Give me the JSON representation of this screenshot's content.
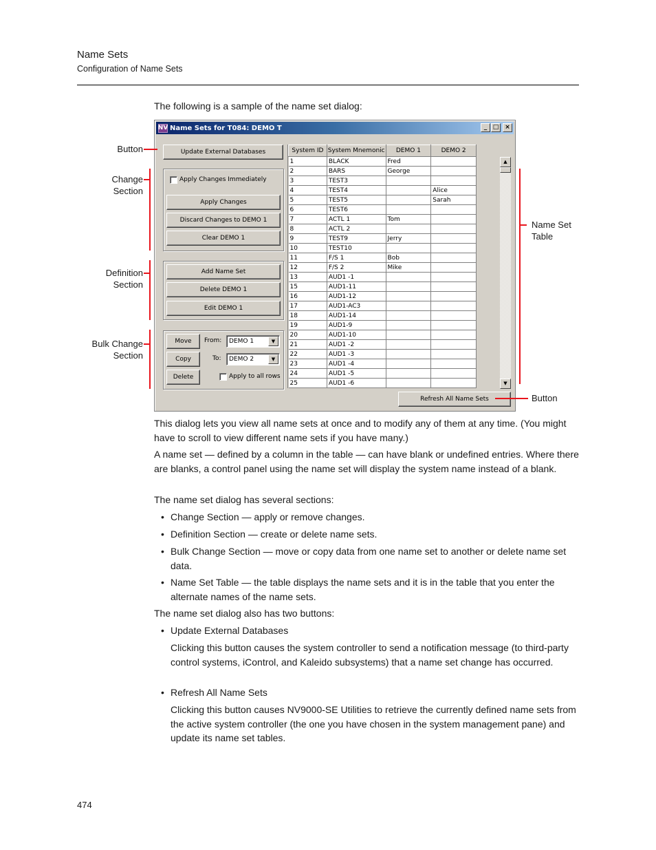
{
  "header": {
    "title": "Name Sets",
    "subtitle": "Configuration of Name Sets"
  },
  "intro": "The following is a sample of the name set dialog:",
  "dialog": {
    "title": "Name Sets for T084: DEMO T",
    "app_icon": "NV",
    "window_controls": {
      "minimize": "_",
      "maximize": "□",
      "close": "×"
    },
    "update_button": "Update External Databases",
    "change_section": {
      "apply_immediately_label": "Apply Changes Immediately",
      "apply_immediately_checked": false,
      "apply_button": "Apply Changes",
      "discard_button": "Discard Changes to DEMO 1",
      "clear_button": "Clear DEMO 1"
    },
    "definition_section": {
      "add_button": "Add Name Set",
      "delete_button": "Delete DEMO 1",
      "edit_button": "Edit DEMO 1"
    },
    "bulk_section": {
      "move_button": "Move",
      "copy_button": "Copy",
      "delete_button": "Delete",
      "from_label": "From:",
      "from_value": "DEMO 1",
      "to_label": "To:",
      "to_value": "DEMO 2",
      "apply_all_label": "Apply to all rows",
      "apply_all_checked": false
    },
    "table": {
      "columns": [
        "System ID",
        "System Mnemonic",
        "DEMO 1",
        "DEMO 2"
      ],
      "rows": [
        [
          "1",
          "BLACK",
          "Fred",
          ""
        ],
        [
          "2",
          "BARS",
          "George",
          ""
        ],
        [
          "3",
          "TEST3",
          "",
          ""
        ],
        [
          "4",
          "TEST4",
          "",
          "Alice"
        ],
        [
          "5",
          "TEST5",
          "",
          "Sarah"
        ],
        [
          "6",
          "TEST6",
          "",
          ""
        ],
        [
          "7",
          "ACTL 1",
          "Tom",
          ""
        ],
        [
          "8",
          "ACTL 2",
          "",
          ""
        ],
        [
          "9",
          "TEST9",
          "Jerry",
          ""
        ],
        [
          "10",
          "TEST10",
          "",
          ""
        ],
        [
          "11",
          "F/S 1",
          "Bob",
          ""
        ],
        [
          "12",
          "F/S 2",
          "Mike",
          ""
        ],
        [
          "13",
          "AUD1 -1",
          "",
          ""
        ],
        [
          "15",
          "AUD1-11",
          "",
          ""
        ],
        [
          "16",
          "AUD1-12",
          "",
          ""
        ],
        [
          "17",
          "AUD1-AC3",
          "",
          ""
        ],
        [
          "18",
          "AUD1-14",
          "",
          ""
        ],
        [
          "19",
          "AUD1-9",
          "",
          ""
        ],
        [
          "20",
          "AUD1-10",
          "",
          ""
        ],
        [
          "21",
          "AUD1 -2",
          "",
          ""
        ],
        [
          "22",
          "AUD1 -3",
          "",
          ""
        ],
        [
          "23",
          "AUD1 -4",
          "",
          ""
        ],
        [
          "24",
          "AUD1 -5",
          "",
          ""
        ],
        [
          "25",
          "AUD1 -6",
          "",
          ""
        ]
      ]
    },
    "refresh_button": "Refresh All Name Sets",
    "scroll_up": "▲",
    "scroll_down": "▼",
    "combo_arrow": "▼"
  },
  "callouts": {
    "button_top": "Button",
    "change": [
      "Change",
      "Section"
    ],
    "definition": [
      "Definition",
      "Section"
    ],
    "bulk": [
      "Bulk Change",
      "Section"
    ],
    "table": [
      "Name Set",
      "Table"
    ],
    "button_bottom": "Button"
  },
  "body": {
    "p1": "This dialog lets you view all name sets at once and to modify any of them at any time. (You might have to scroll to view different name sets if you have many.)",
    "p2": "A name set — defined by a column in the table — can have blank or undefined entries. Where there are blanks, a control panel using the name set will display the system name instead of a blank.",
    "p3": "The name set dialog has several sections:",
    "sections": [
      "Change Section — apply or remove changes.",
      "Definition Section — create or delete name sets.",
      "Bulk Change Section — move or copy data from one name set to another or delete name set data.",
      "Name Set Table — the table displays the name sets and it is in the table that you enter the alternate names of the name sets."
    ],
    "p4": "The name set dialog also has two buttons:",
    "buttons": [
      {
        "name": "Update External Databases",
        "desc": "Clicking this button causes the system controller to send a notification message (to third-party control systems, iControl, and Kaleido subsystems) that a name set change has occurred."
      },
      {
        "name": "Refresh All Name Sets",
        "desc": "Clicking this button causes NV9000-SE Utilities to retrieve the currently defined name sets from the active system controller (the one you have chosen in the system management pane) and update its name set tables."
      }
    ]
  },
  "page_number": "474"
}
